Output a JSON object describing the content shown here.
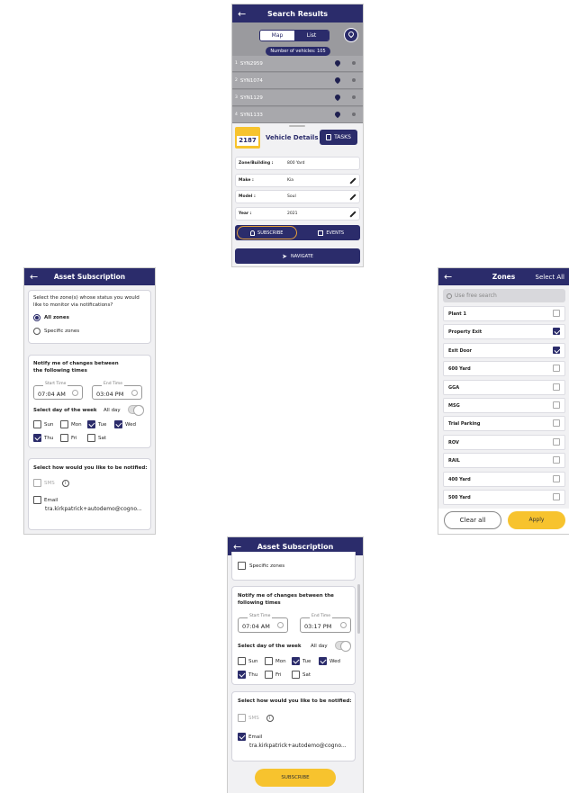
{
  "screen1": {
    "title": "Search Results",
    "toggle": {
      "map": "Map",
      "list": "List"
    },
    "vehicle_count": "Number of vehicles: 105",
    "vehicles": [
      {
        "index": "1",
        "name": "SYN2959"
      },
      {
        "index": "2",
        "name": "SYN1074"
      },
      {
        "index": "3",
        "name": "SYN1129"
      },
      {
        "index": "4",
        "name": "SYN1133"
      }
    ],
    "vehicle_badge": "2187",
    "details_title": "Vehicle Details",
    "tasks_label": "TASKS",
    "fields": [
      {
        "label": "Zone/Building :",
        "value": "800 Yard",
        "editable": false
      },
      {
        "label": "Make :",
        "value": "Kia",
        "editable": true
      },
      {
        "label": "Model :",
        "value": "Soul",
        "editable": true
      },
      {
        "label": "Year :",
        "value": "2021",
        "editable": true
      }
    ],
    "subscribe_label": "SUBSCRIBE",
    "events_label": "EVENTS",
    "navigate_label": "NAVIGATE"
  },
  "screen2": {
    "title": "Asset Subscription",
    "zone_question": "Select the zone(s) whose status you would like to monitor via notifications?",
    "all_zones": "All zones",
    "specific_zones": "Specific zones",
    "notify_heading": "Notify me of changes between the following times",
    "start_label": "Start Time",
    "start_time": "07:04 AM",
    "end_label": "End Time",
    "end_time": "03:04 PM",
    "day_heading": "Select day of the week",
    "all_day": "All day",
    "days": [
      {
        "label": "Sun",
        "checked": false
      },
      {
        "label": "Mon",
        "checked": false
      },
      {
        "label": "Tue",
        "checked": true
      },
      {
        "label": "Wed",
        "checked": true
      },
      {
        "label": "Thu",
        "checked": true
      },
      {
        "label": "Fri",
        "checked": false
      },
      {
        "label": "Sat",
        "checked": false
      }
    ],
    "notify_method_heading": "Select how would you like to be notified:",
    "sms_label": "SMS",
    "email_label": "Email",
    "email_address": "tra.kirkpatrick+autodemo@cogno..."
  },
  "screen3": {
    "title": "Zones",
    "select_all": "Select All",
    "search_placeholder": "Use free search",
    "zones": [
      {
        "name": "Plant 1",
        "checked": false
      },
      {
        "name": "Property Exit",
        "checked": true
      },
      {
        "name": "Exit Door",
        "checked": true
      },
      {
        "name": "600 Yard",
        "checked": false
      },
      {
        "name": "GGA",
        "checked": false
      },
      {
        "name": "MSG",
        "checked": false
      },
      {
        "name": "Trial Parking",
        "checked": false
      },
      {
        "name": "ROV",
        "checked": false
      },
      {
        "name": "RAIL",
        "checked": false
      },
      {
        "name": "400 Yard",
        "checked": false
      },
      {
        "name": "500 Yard",
        "checked": false
      }
    ],
    "clear_all": "Clear all",
    "apply": "Apply"
  },
  "screen4": {
    "title": "Asset Subscription",
    "specific_zones": "Specific zones",
    "notify_heading": "Notify me of changes between the following times",
    "start_label": "Start Time",
    "start_time": "07:04 AM",
    "end_label": "End Time",
    "end_time": "03:17 PM",
    "day_heading": "Select day of the week",
    "all_day": "All day",
    "days": [
      {
        "label": "Sun",
        "checked": false
      },
      {
        "label": "Mon",
        "checked": false
      },
      {
        "label": "Tue",
        "checked": true
      },
      {
        "label": "Wed",
        "checked": true
      },
      {
        "label": "Thu",
        "checked": true
      },
      {
        "label": "Fri",
        "checked": false
      },
      {
        "label": "Sat",
        "checked": false
      }
    ],
    "notify_method_heading": "Select how would you like to be notified:",
    "sms_label": "SMS",
    "email_label": "Email",
    "email_address": "tra.kirkpatrick+autodemo@cogno...",
    "subscribe_label": "SUBSCRIBE"
  },
  "colors": {
    "navy": "#2b2c6b",
    "yellow": "#f7c32e",
    "background": "#f1f1f3"
  }
}
